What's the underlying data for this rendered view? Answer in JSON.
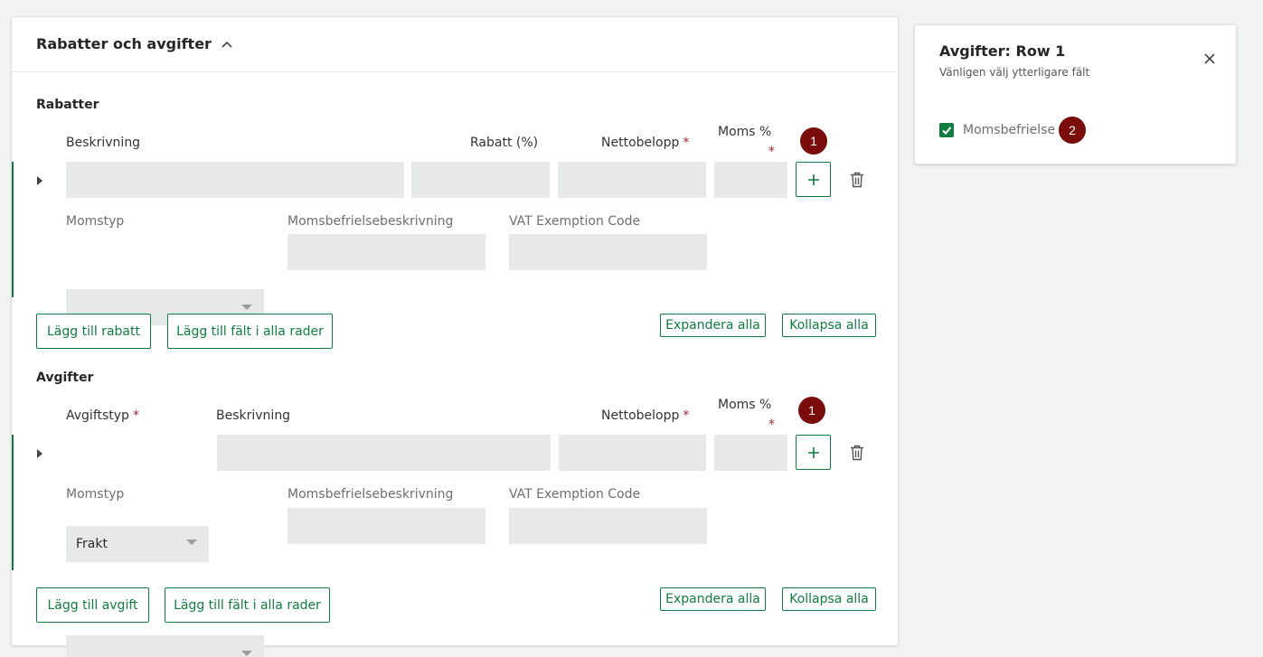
{
  "section": {
    "title": "Rabatter och avgifter"
  },
  "discounts": {
    "title": "Rabatter",
    "headers": {
      "description": "Beskrivning",
      "discount_pct": "Rabatt (%)",
      "net_amount": "Nettobelopp",
      "vat_pct": "Moms %"
    },
    "sub_headers": {
      "vat_type": "Momstyp",
      "exemption_desc": "Momsbefrielsebeskrivning",
      "exemption_code": "VAT Exemption Code"
    },
    "required_mark": "*",
    "badge": "1",
    "add_button": "Lägg till rabatt",
    "add_field_all_rows": "Lägg till fält i alla rader",
    "expand_all": "Expandera alla",
    "collapse_all": "Kollapsa alla"
  },
  "fees": {
    "title": "Avgifter",
    "headers": {
      "fee_type": "Avgiftstyp",
      "description": "Beskrivning",
      "net_amount": "Nettobelopp",
      "vat_pct": "Moms %"
    },
    "sub_headers": {
      "vat_type": "Momstyp",
      "exemption_desc": "Momsbefrielsebeskrivning",
      "exemption_code": "VAT Exemption Code"
    },
    "required_mark": "*",
    "fee_type_value": "Frakt",
    "badge": "1",
    "add_button": "Lägg till avgift",
    "add_field_all_rows": "Lägg till fält i alla rader",
    "expand_all": "Expandera alla",
    "collapse_all": "Kollapsa alla"
  },
  "side_panel": {
    "title": "Avgifter: Row 1",
    "subtitle": "Vänligen välj ytterligare fält",
    "checkbox_label": "Momsbefrielse",
    "checkbox_checked": true,
    "badge": "2"
  },
  "colors": {
    "accent": "#107c41",
    "badge": "#7a0c0c",
    "required": "#a4262c"
  }
}
